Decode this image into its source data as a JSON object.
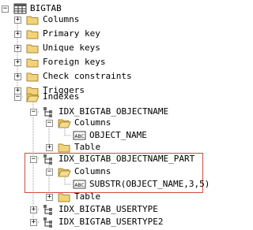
{
  "tree": {
    "root": {
      "label": "BIGTAB",
      "icon": "table-icon"
    },
    "groups": [
      {
        "label": "Columns",
        "icon": "folder-icon"
      },
      {
        "label": "Primary key",
        "icon": "folder-icon"
      },
      {
        "label": "Unique keys",
        "icon": "folder-icon"
      },
      {
        "label": "Foreign keys",
        "icon": "folder-icon"
      },
      {
        "label": "Check constraints",
        "icon": "folder-icon"
      },
      {
        "label": "Triggers",
        "icon": "folder-icon"
      },
      {
        "label": "Indexes",
        "icon": "folder-open-icon"
      }
    ],
    "indexes": [
      {
        "label": "IDX_BIGTAB_OBJECTNAME",
        "icon": "index-icon",
        "columns_label": "Columns",
        "column": {
          "label": "OBJECT_NAME",
          "icon": "column-type-icon",
          "badge": "ABC"
        },
        "table_label": "Table"
      },
      {
        "label": "IDX_BIGTAB_OBJECTNAME_PART",
        "icon": "index-icon",
        "columns_label": "Columns",
        "column": {
          "label": "SUBSTR(OBJECT_NAME,3,5)",
          "icon": "column-type-icon",
          "badge": "ABC"
        },
        "table_label": "Table"
      },
      {
        "label": "IDX_BIGTAB_USERTYPE",
        "icon": "index-icon"
      },
      {
        "label": "IDX_BIGTAB_USERTYPE2",
        "icon": "index-icon"
      }
    ]
  },
  "colors": {
    "highlight_border": "#d24b3a",
    "folder": "#f2d27a",
    "line": "#9a9a9a"
  }
}
